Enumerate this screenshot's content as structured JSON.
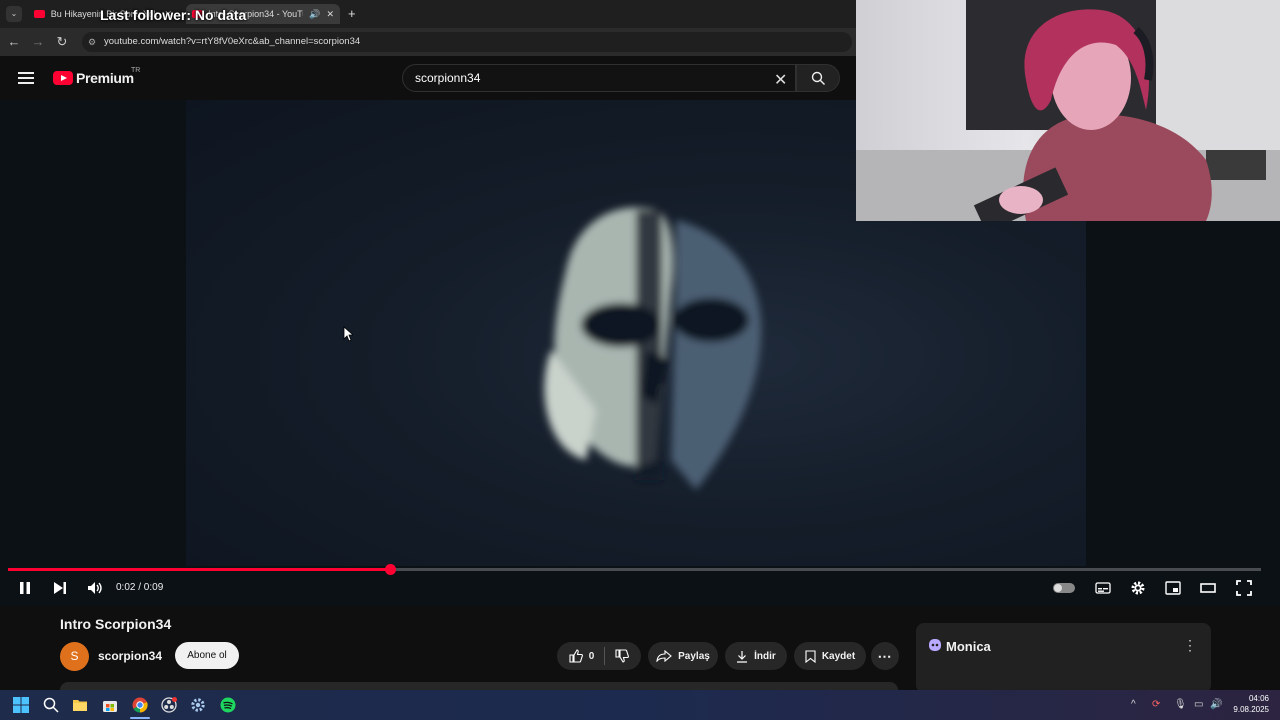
{
  "browser": {
    "tabs": [
      {
        "label": "Bu Hikayenin Bir Sonu Yok..."
      },
      {
        "label": "Intro Scorpion34 - YouTube"
      }
    ],
    "url": "youtube.com/watch?v=rtY8fV0eXrc&ab_channel=scorpion34"
  },
  "overlay": {
    "last_follower": "Last follower: No data"
  },
  "youtube": {
    "logo_text": "Premium",
    "logo_badge": "TR",
    "search_value": "scorpionn34"
  },
  "player": {
    "time": "0:02 / 0:09",
    "progress": 0.305
  },
  "video": {
    "title": "Intro Scorpion34",
    "channel_initial": "S",
    "channel_name": "scorpion34",
    "subscribe_label": "Abone ol",
    "like_count": "0",
    "share_label": "Paylaş",
    "download_label": "İndir",
    "save_label": "Kaydet"
  },
  "sidepanel": {
    "title": "Monica"
  },
  "taskbar": {
    "time": "04:06",
    "date": "9.08.2025"
  },
  "colors": {
    "accent": "#ff0033",
    "background": "#0f0f0f"
  }
}
